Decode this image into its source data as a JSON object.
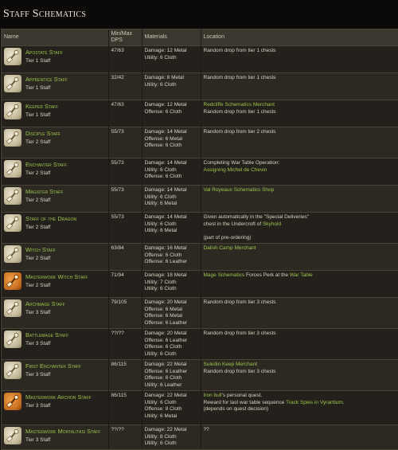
{
  "page": {
    "title": "Staff Schematics"
  },
  "columns": {
    "name": "Name",
    "dps": "Min/Max\nDPS",
    "dps_line1": "Min/Max",
    "dps_line2": "DPS",
    "materials": "Materials",
    "location": "Location"
  },
  "rows": [
    {
      "name": "Apostate Staff",
      "tier": "Tier 1 Staff",
      "dps": "47/63",
      "icon": "staff-icon",
      "materials": [
        "Damage: 12 Metal",
        "Utility: 6 Cloth"
      ],
      "location": [
        [
          {
            "t": "Random drop from tier 1 chests",
            "link": false
          }
        ]
      ]
    },
    {
      "name": "Apprentice Staff",
      "tier": "Tier 1 Staff",
      "dps": "32/42",
      "icon": "staff-icon",
      "materials": [
        "Damage: 8 Metal",
        "Utility: 6 Cloth"
      ],
      "location": [
        [
          {
            "t": "Random drop from tier 1 chests",
            "link": false
          }
        ]
      ]
    },
    {
      "name": "Keeper Staff",
      "tier": "Tier 1 Staff",
      "dps": "47/63",
      "icon": "staff-icon",
      "materials": [
        "Damage: 12 Metal",
        "Offense: 6 Cloth"
      ],
      "location": [
        [
          {
            "t": "Redcliffe Schematics Merchant",
            "link": true
          }
        ],
        [
          {
            "t": "Random drop from tier 1 chests",
            "link": false
          }
        ]
      ]
    },
    {
      "name": "Disciple Staff",
      "tier": "Tier 2 Staff",
      "dps": "55/73",
      "icon": "staff-icon",
      "materials": [
        "Damage: 14 Metal",
        "Offense: 6 Metal",
        "Offense: 6 Cloth"
      ],
      "location": [
        [
          {
            "t": "Random drop from tier 2 chests",
            "link": false
          }
        ]
      ]
    },
    {
      "name": "Enchanter Staff",
      "tier": "Tier 2 Staff",
      "dps": "55/73",
      "icon": "staff-icon",
      "materials": [
        "Damage: 14 Metal",
        "Utility: 6 Cloth",
        "Offense: 6 Cloth"
      ],
      "location": [
        [
          {
            "t": "Completing War Table Operation:",
            "link": false
          }
        ],
        [
          {
            "t": "Assigning Michel de Chevin",
            "link": true
          }
        ]
      ]
    },
    {
      "name": "Magister Staff",
      "tier": "Tier 2 Staff",
      "dps": "55/73",
      "icon": "staff-icon",
      "materials": [
        "Damage: 14 Metal",
        "Utility: 6 Cloth",
        "Utility: 6 Metal"
      ],
      "location": [
        [
          {
            "t": "Val Royeaux Schematics Shop",
            "link": true
          }
        ]
      ]
    },
    {
      "name": "Staff of the Dragon",
      "tier": "Tier 2 Staff",
      "dps": "55/73",
      "icon": "staff-icon",
      "materials": [
        "Damage: 14 Metal",
        "Utility: 6 Cloth",
        "Utility: 6 Metal"
      ],
      "location": [
        [
          {
            "t": "Given automatically in the \"Special Deliveries\"",
            "link": false
          }
        ],
        [
          {
            "t": "chest in the Undercroft of ",
            "link": false
          },
          {
            "t": "Skyhold",
            "link": true
          }
        ],
        [
          {
            "t": "",
            "link": false
          }
        ],
        [
          {
            "t": "(part of pre-ordering)",
            "link": false
          }
        ]
      ]
    },
    {
      "name": "Witch Staff",
      "tier": "Tier 2 Staff",
      "dps": "63/84",
      "icon": "staff-icon",
      "materials": [
        "Damage: 16 Metal",
        "Offense: 6 Cloth",
        "Offense: 6 Leather"
      ],
      "location": [
        [
          {
            "t": "Dalish Camp Merchant",
            "link": true
          }
        ]
      ]
    },
    {
      "name": "Masterwork Witch Staff",
      "tier": "Tier 2 Staff",
      "dps": "71/94",
      "icon": "masterwork-staff-icon",
      "materials": [
        "Damage: 18 Metal",
        "Utility: 7 Cloth",
        "Utility: 6 Cloth"
      ],
      "location": [
        [
          {
            "t": "Mage Schematics",
            "link": true
          },
          {
            "t": " Forces Perk at the ",
            "link": false
          },
          {
            "t": "War Table",
            "link": true
          }
        ]
      ]
    },
    {
      "name": "Archmage Staff",
      "tier": "Tier 3 Staff",
      "dps": "79/105",
      "icon": "staff-icon",
      "materials": [
        "Damage: 20 Metal",
        "Offense: 6 Metal",
        "Offense: 6 Metal",
        "Offense: 6 Leather"
      ],
      "location": [
        [
          {
            "t": "Random drop from tier 3 chests",
            "link": false
          }
        ]
      ]
    },
    {
      "name": "Battlemage Staff",
      "tier": "Tier 3 Staff",
      "dps": "??/??",
      "icon": "staff-icon",
      "materials": [
        "Damage: 20 Metal",
        "Offense: 6 Leather",
        "Offense: 6 Cloth",
        "Utility: 6 Cloth"
      ],
      "location": [
        [
          {
            "t": "Random drop from tier 3 chests",
            "link": false
          }
        ]
      ]
    },
    {
      "name": "First Enchanter Staff",
      "tier": "Tier 3 Staff",
      "dps": "86/115",
      "icon": "staff-icon",
      "materials": [
        "Damage: 22 Metal",
        "Offense: 6 Leather",
        "Offense: 6 Cloth",
        "Utility: 6 Leather"
      ],
      "location": [
        [
          {
            "t": "Suledin Keep Merchant",
            "link": true
          }
        ],
        [
          {
            "t": "Random drop from tier 3 chests",
            "link": false
          }
        ]
      ]
    },
    {
      "name": "Masterwork Archon Staff",
      "tier": "Tier 3 Staff",
      "dps": "86/115",
      "icon": "masterwork-staff-icon",
      "materials": [
        "Damage: 22 Metal",
        "Utility: 6 Cloth",
        "Offense: 8 Cloth",
        "Utility: 6 Metal"
      ],
      "location": [
        [
          {
            "t": "Iron bull",
            "link": true
          },
          {
            "t": "'s personal quest.",
            "link": false
          }
        ],
        [
          {
            "t": "Reward for last war table sequence ",
            "link": false
          },
          {
            "t": "Track Spies in Vyrantium",
            "link": true
          },
          {
            "t": ".",
            "link": false
          }
        ],
        [
          {
            "t": "(depends on quest decision)",
            "link": false
          }
        ]
      ]
    },
    {
      "name": "Masterwork Mortalitasi Staff",
      "tier": "Tier 3 Staff",
      "dps": "??/??",
      "icon": "staff-icon",
      "materials": [
        "Damage: 22 Metal",
        "Utility: 8 Cloth",
        "Utility: 6 Cloth"
      ],
      "location": [
        [
          {
            "t": "??",
            "link": false
          }
        ]
      ]
    }
  ]
}
